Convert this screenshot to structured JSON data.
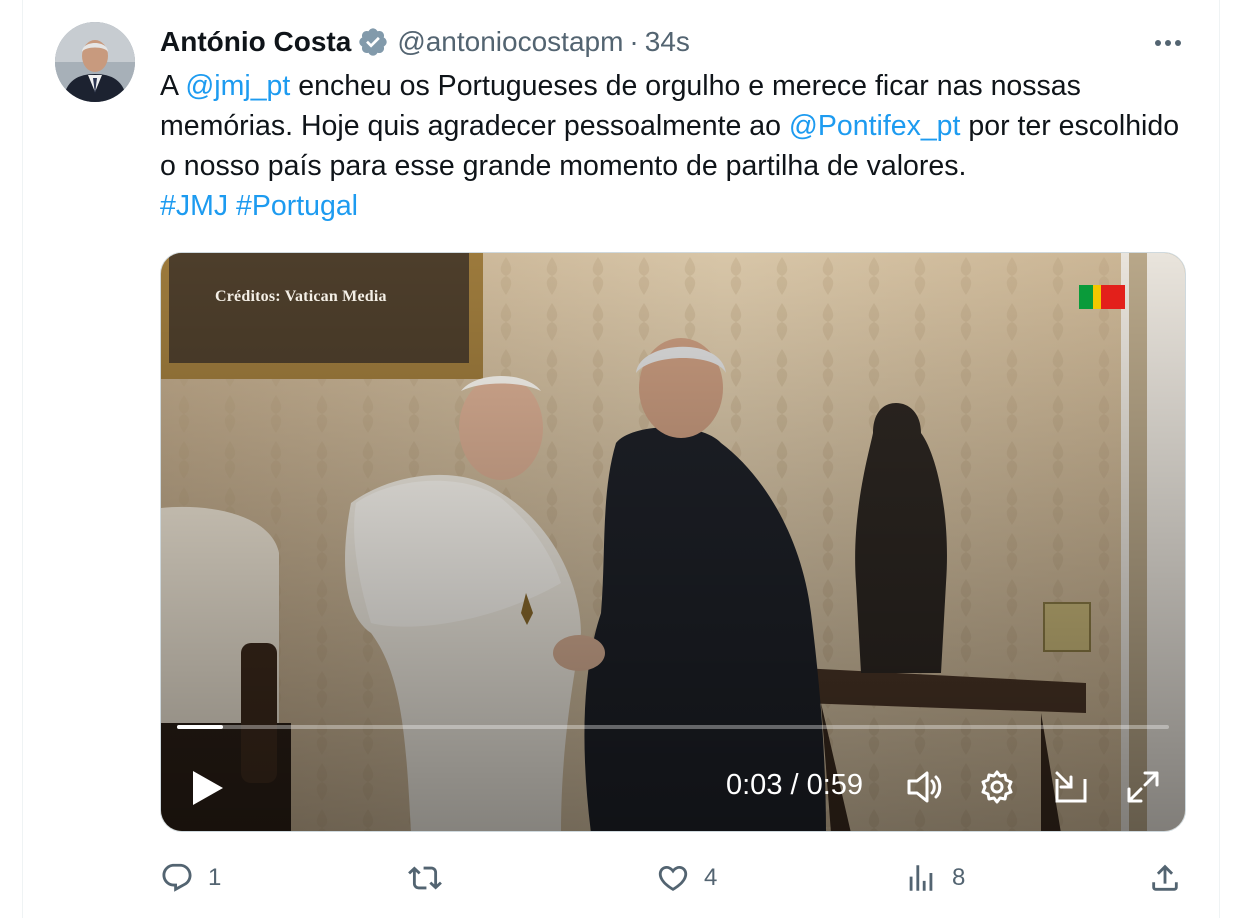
{
  "tweet": {
    "author_name": "António Costa",
    "handle": "@antoniocostapm",
    "separator": "·",
    "time": "34s",
    "text": {
      "p1": "A ",
      "mention1": "@jmj_pt",
      "p2": " encheu os Portugueses de orgulho e merece ficar nas nossas memórias. Hoje quis agradecer pessoalmente ao ",
      "mention2": "@Pontifex_pt",
      "p3": " por ter escolhido o nosso país para esse grande momento de partilha de valores.",
      "hashtag1": "#JMJ",
      "hashtag2": "#Portugal"
    }
  },
  "video": {
    "credit": "Créditos: Vatican Media",
    "timecode": "0:03 / 0:59",
    "progress": 0.046,
    "flag_colors": [
      "#0a9b3a",
      "#f5c800",
      "#e3201b"
    ]
  },
  "actions": {
    "replies": "1",
    "retweets": "",
    "likes": "4",
    "views": "8"
  },
  "colors": {
    "accent": "#1d9bf0",
    "secondary_text": "#536471",
    "primary_text": "#0f1419"
  },
  "icons": [
    "verified-badge-icon",
    "more-icon",
    "play-icon",
    "volume-icon",
    "settings-icon",
    "dock-icon",
    "fullscreen-icon",
    "reply-icon",
    "retweet-icon",
    "like-icon",
    "views-icon",
    "share-icon"
  ]
}
